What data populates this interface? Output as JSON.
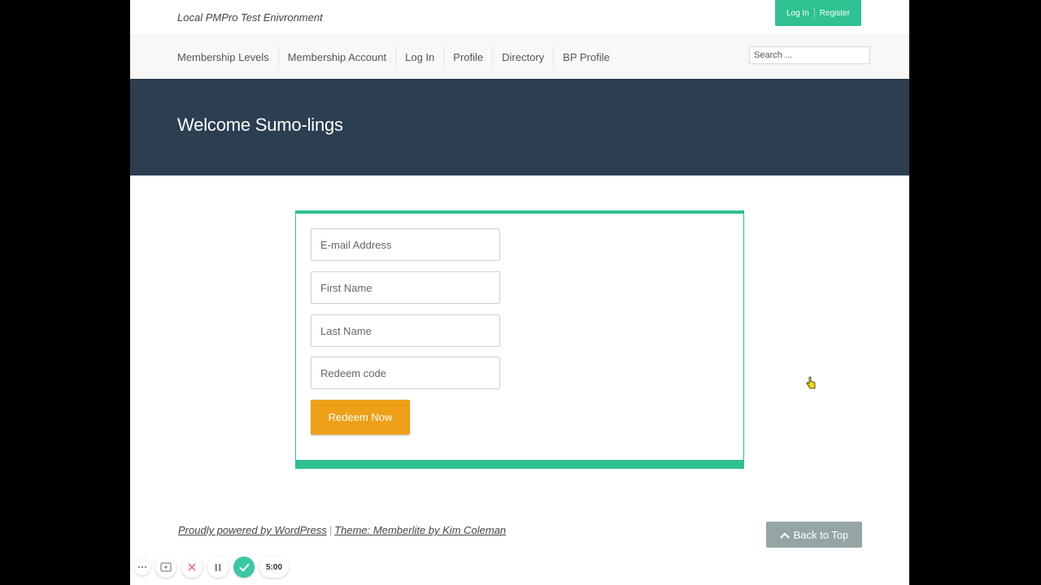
{
  "site": {
    "description": "Local PMPro Test Enivronment"
  },
  "top_meta": {
    "login": "Log In",
    "register": "Register",
    "accent_color": "#2fc192"
  },
  "nav": {
    "items": [
      {
        "label": "Membership Levels"
      },
      {
        "label": "Membership Account"
      },
      {
        "label": "Log In"
      },
      {
        "label": "Profile"
      },
      {
        "label": "Directory"
      },
      {
        "label": "BP Profile"
      }
    ]
  },
  "search": {
    "placeholder": "Search ..."
  },
  "hero": {
    "title": "Welcome Sumo-lings",
    "background_color": "#2c3e50"
  },
  "form": {
    "email_placeholder": "E-mail Address",
    "first_name_placeholder": "First Name",
    "last_name_placeholder": "Last Name",
    "code_placeholder": "Redeem code",
    "submit_label": "Redeem Now",
    "button_color": "#eea019"
  },
  "footer": {
    "powered_by": "Proudly powered by WordPress",
    "separator": "|",
    "theme": "Theme: Memberlite by Kim Coleman",
    "back_to_top": "Back to Top",
    "back_to_top_icon": "chevron-up-icon"
  },
  "recorder": {
    "timer": "5:00"
  }
}
